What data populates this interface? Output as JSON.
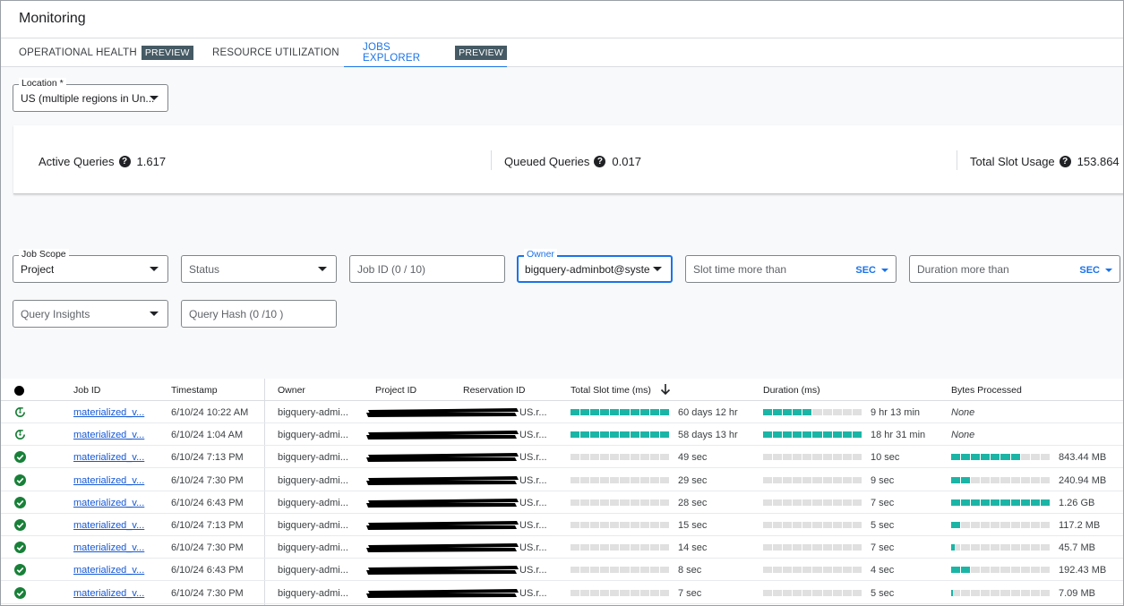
{
  "app": {
    "title": "Monitoring"
  },
  "tabs": [
    {
      "label": "OPERATIONAL HEALTH",
      "badge": "PREVIEW"
    },
    {
      "label": "RESOURCE UTILIZATION",
      "badge": ""
    },
    {
      "label": "JOBS EXPLORER",
      "badge": "PREVIEW"
    }
  ],
  "location": {
    "label": "Location *",
    "value": "US (multiple regions in Un..."
  },
  "metrics": [
    {
      "label": "Active Queries",
      "value": "1.617"
    },
    {
      "label": "Queued Queries",
      "value": "0.017"
    },
    {
      "label": "Total Slot Usage",
      "value": "153.864"
    }
  ],
  "filters": {
    "job_scope": {
      "label": "Job Scope",
      "value": "Project"
    },
    "status": {
      "placeholder": "Status"
    },
    "job_id": {
      "placeholder": "Job ID (0 / 10)"
    },
    "owner": {
      "label": "Owner",
      "value": "bigquery-adminbot@syste..."
    },
    "slot_time": {
      "placeholder": "Slot time more than",
      "unit": "SEC"
    },
    "duration": {
      "placeholder": "Duration more than",
      "unit": "SEC"
    },
    "query_insights": {
      "placeholder": "Query Insights"
    },
    "query_hash": {
      "placeholder": "Query Hash (0 /10 )"
    }
  },
  "table": {
    "headers": {
      "job_id": "Job ID",
      "timestamp": "Timestamp",
      "owner": "Owner",
      "project_id": "Project ID",
      "reservation_id": "Reservation ID",
      "slot_time": "Total Slot time (ms)",
      "duration": "Duration (ms)",
      "bytes": "Bytes Processed"
    },
    "rows": [
      {
        "status": "running",
        "job_id": "materialized_v...",
        "timestamp": "6/10/24 10:22 AM",
        "owner": "bigquery-admi...",
        "reservation": "US.r...",
        "slot_time": "60 days 12 hr",
        "slot_fill": 1.0,
        "duration": "9 hr 13 min",
        "duration_fill": 0.5,
        "bytes": "None",
        "bytes_fill": null
      },
      {
        "status": "running",
        "job_id": "materialized_v...",
        "timestamp": "6/10/24 1:04 AM",
        "owner": "bigquery-admi...",
        "reservation": "US.r...",
        "slot_time": "58 days 13 hr",
        "slot_fill": 0.97,
        "duration": "18 hr 31 min",
        "duration_fill": 1.0,
        "bytes": "None",
        "bytes_fill": null
      },
      {
        "status": "done",
        "job_id": "materialized_v...",
        "timestamp": "6/10/24 7:13 PM",
        "owner": "bigquery-admi...",
        "reservation": "US.r...",
        "slot_time": "49 sec",
        "slot_fill": 0.0,
        "duration": "10 sec",
        "duration_fill": 0.0,
        "bytes": "843.44 MB",
        "bytes_fill": 0.65
      },
      {
        "status": "done",
        "job_id": "materialized_v...",
        "timestamp": "6/10/24 7:30 PM",
        "owner": "bigquery-admi...",
        "reservation": "US.r...",
        "slot_time": "29 sec",
        "slot_fill": 0.0,
        "duration": "9 sec",
        "duration_fill": 0.0,
        "bytes": "240.94 MB",
        "bytes_fill": 0.19
      },
      {
        "status": "done",
        "job_id": "materialized_v...",
        "timestamp": "6/10/24 6:43 PM",
        "owner": "bigquery-admi...",
        "reservation": "US.r...",
        "slot_time": "28 sec",
        "slot_fill": 0.0,
        "duration": "7 sec",
        "duration_fill": 0.0,
        "bytes": "1.26 GB",
        "bytes_fill": 1.0
      },
      {
        "status": "done",
        "job_id": "materialized_v...",
        "timestamp": "6/10/24 7:13 PM",
        "owner": "bigquery-admi...",
        "reservation": "US.r...",
        "slot_time": "15 sec",
        "slot_fill": 0.0,
        "duration": "5 sec",
        "duration_fill": 0.0,
        "bytes": "117.2 MB",
        "bytes_fill": 0.09
      },
      {
        "status": "done",
        "job_id": "materialized_v...",
        "timestamp": "6/10/24 7:30 PM",
        "owner": "bigquery-admi...",
        "reservation": "US.r...",
        "slot_time": "14 sec",
        "slot_fill": 0.0,
        "duration": "7 sec",
        "duration_fill": 0.0,
        "bytes": "45.7 MB",
        "bytes_fill": 0.04
      },
      {
        "status": "done",
        "job_id": "materialized_v...",
        "timestamp": "6/10/24 6:43 PM",
        "owner": "bigquery-admi...",
        "reservation": "US.r...",
        "slot_time": "8 sec",
        "slot_fill": 0.0,
        "duration": "4 sec",
        "duration_fill": 0.0,
        "bytes": "192.43 MB",
        "bytes_fill": 0.15
      },
      {
        "status": "done",
        "job_id": "materialized_v...",
        "timestamp": "6/10/24 7:30 PM",
        "owner": "bigquery-admi...",
        "reservation": "US.r...",
        "slot_time": "7 sec",
        "slot_fill": 0.0,
        "duration": "5 sec",
        "duration_fill": 0.0,
        "bytes": "7.09 MB",
        "bytes_fill": 0.01
      }
    ]
  },
  "colors": {
    "accent": "#1a73e8",
    "bar": "#1bb5a6",
    "bar_empty": "#e0e0e0",
    "success": "#188038",
    "badge": "#455a64"
  }
}
